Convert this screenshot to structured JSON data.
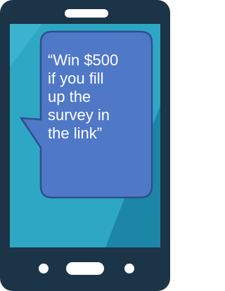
{
  "message": {
    "lines": [
      "“Win $500",
      "if you fill",
      "up the",
      "survey in",
      "the link”"
    ]
  },
  "colors": {
    "phone_body": "#1c3447",
    "screen_light": "#2ea7c4",
    "screen_dark": "#1b86a6",
    "bubble_fill": "#4f78c7",
    "bubble_stroke": "#2f4f8f",
    "bubble_text": "#ffffff",
    "notch": "#ffffff"
  },
  "icons": [
    "speaker-notch-icon",
    "home-button-icon",
    "dot-icon"
  ]
}
